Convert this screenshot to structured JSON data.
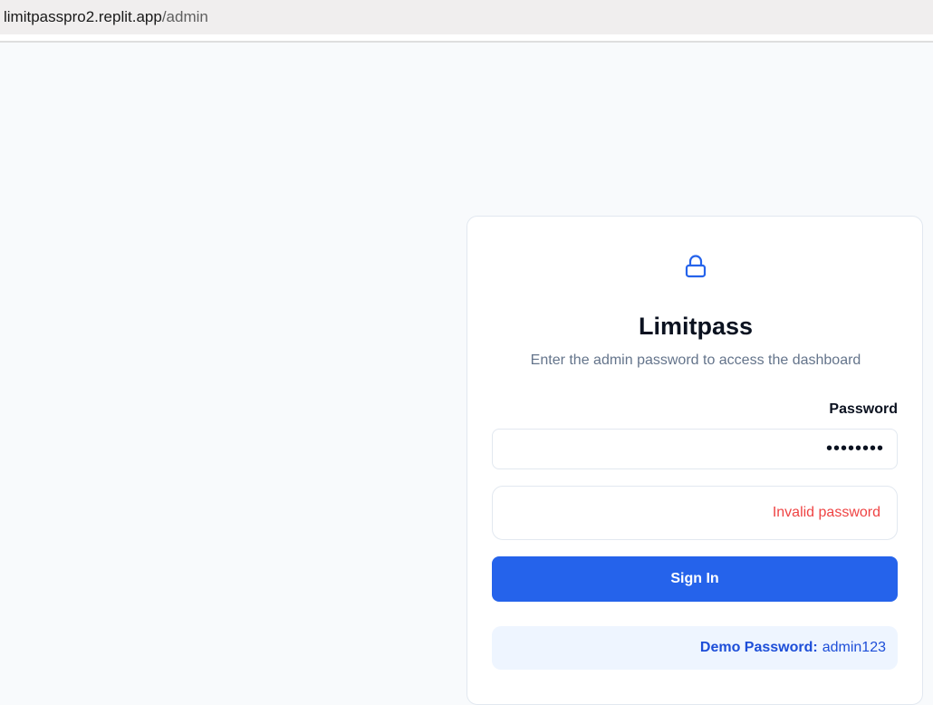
{
  "browser": {
    "url_host": "limitpasspro2.replit.app",
    "url_path": "/admin"
  },
  "login": {
    "icon": "lock-icon",
    "title": "Limitpass",
    "subtitle": "Enter the admin password to access the dashboard",
    "password_label": "Password",
    "password_value": "••••••••",
    "error_message": "Invalid password",
    "sign_in_label": "Sign In",
    "demo_label": "Demo Password:",
    "demo_value": "admin123"
  },
  "colors": {
    "accent": "#2563eb",
    "error": "#ef4444",
    "demo_bg": "#eef5ff"
  }
}
